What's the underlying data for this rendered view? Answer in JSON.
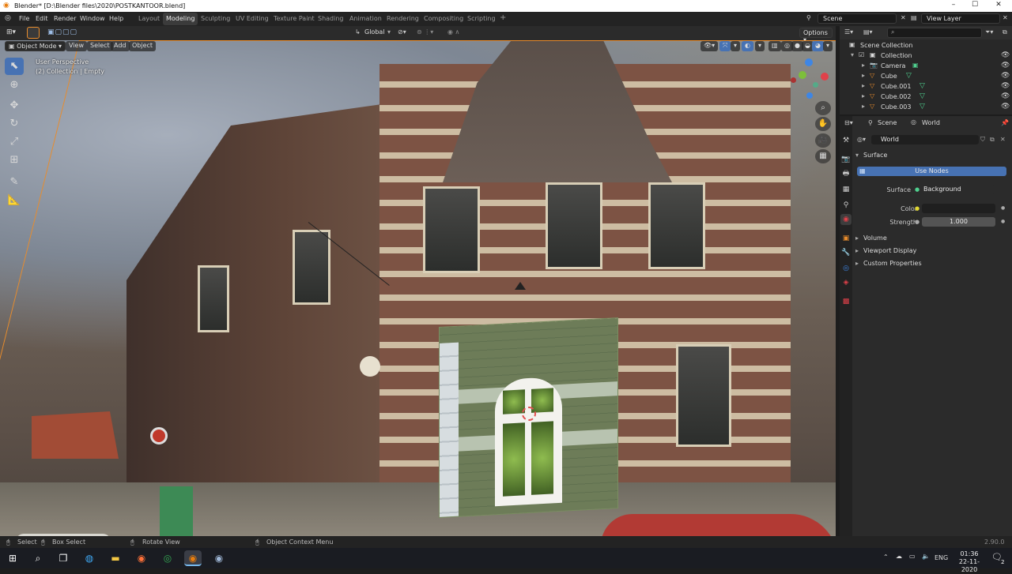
{
  "window": {
    "title": "Blender* [D:\\Blender files\\2020\\POSTKANTOOR.blend]",
    "minimize": "–",
    "maximize": "☐",
    "close": "✕"
  },
  "menu": [
    "File",
    "Edit",
    "Render",
    "Window",
    "Help"
  ],
  "workspaces": [
    {
      "label": "Layout",
      "active": false
    },
    {
      "label": "Modeling",
      "active": true
    },
    {
      "label": "Sculpting",
      "active": false
    },
    {
      "label": "UV Editing",
      "active": false
    },
    {
      "label": "Texture Paint",
      "active": false
    },
    {
      "label": "Shading",
      "active": false
    },
    {
      "label": "Animation",
      "active": false
    },
    {
      "label": "Rendering",
      "active": false
    },
    {
      "label": "Compositing",
      "active": false
    },
    {
      "label": "Scripting",
      "active": false
    }
  ],
  "add_workspace": "+",
  "scene_selector": "Scene",
  "view_layer_selector": "View Layer",
  "viewport": {
    "transform_orientation": "Global",
    "options_label": "Options",
    "mode": "Object Mode",
    "menus": [
      "View",
      "Select",
      "Add",
      "Object"
    ],
    "info_line1": "User Perspective",
    "info_line2": "(2) Collection | Empty",
    "gizmo_axes": {
      "x": "X",
      "y": "Y",
      "z": "Z"
    }
  },
  "outliner": {
    "search_placeholder": "",
    "scene_collection": "Scene Collection",
    "collection": "Collection",
    "items": [
      "Camera",
      "Cube",
      "Cube.001",
      "Cube.002",
      "Cube.003"
    ]
  },
  "properties": {
    "scene_tab": "Scene",
    "world_tab": "World",
    "world_name": "World",
    "surface_panel": "Surface",
    "use_nodes_label": "Use Nodes",
    "surface_label": "Surface",
    "surface_value": "Background",
    "color_label": "Color",
    "strength_label": "Strength",
    "strength_value": "1.000",
    "collapsed_panels": [
      "Volume",
      "Viewport Display",
      "Custom Properties"
    ]
  },
  "statusbar": {
    "select": "Select",
    "box_select": "Box Select",
    "rotate_view": "Rotate View",
    "context_menu": "Object Context Menu",
    "version": "2.90.0"
  },
  "taskbar": {
    "language": "ENG",
    "time": "01:36",
    "date": "22-11-2020",
    "notification_count": "2"
  },
  "colors": {
    "accent_blue": "#4772b3",
    "selection_orange": "#e88c2c",
    "x_axis": "#e0414a",
    "y_axis": "#7dbf3b",
    "z_axis": "#3e86e5"
  }
}
